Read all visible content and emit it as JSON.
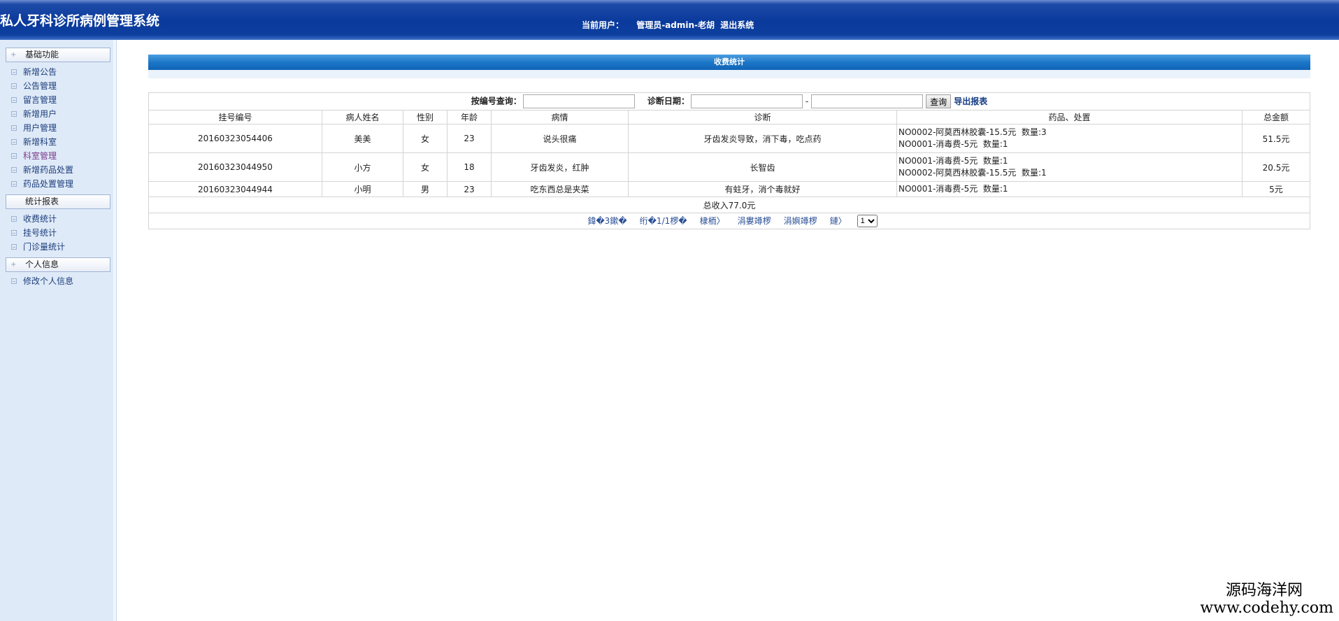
{
  "header": {
    "title": "私人牙科诊所病例管理系统",
    "current_user_label": "当前用户：",
    "current_user": "管理员-admin-老胡",
    "logout": "退出系统"
  },
  "sidebar": {
    "sections": [
      {
        "title": "基础功能",
        "items": [
          "新增公告",
          "公告管理",
          "留言管理",
          "新增用户",
          "用户管理",
          "新增科室",
          "科室管理",
          "新增药品处置",
          "药品处置管理"
        ]
      },
      {
        "title": "统计报表",
        "items": [
          "收费统计",
          "挂号统计",
          "门诊量统计"
        ]
      },
      {
        "title": "个人信息",
        "items": [
          "修改个人信息"
        ]
      }
    ]
  },
  "main": {
    "panel_title": "收费统计",
    "search": {
      "by_number_label": "按编号查询：",
      "by_number_value": "",
      "date_label": "诊断日期：",
      "date_from": "",
      "date_sep": "-",
      "date_to": "",
      "query_button": "查询",
      "export_link": "导出报表"
    },
    "columns": [
      "挂号编号",
      "病人姓名",
      "性别",
      "年龄",
      "病情",
      "诊断",
      "药品、处置",
      "总金额"
    ],
    "rows": [
      {
        "reg_no": "20160323054406",
        "name": "美美",
        "gender": "女",
        "age": "23",
        "condition": "说头很痛",
        "diagnosis": "牙齿发炎导致，消下毒，吃点药",
        "meds": [
          "NO0002-阿莫西林胶囊-15.5元  数量:3",
          "NO0001-消毒费-5元  数量:1"
        ],
        "total": "51.5元"
      },
      {
        "reg_no": "20160323044950",
        "name": "小方",
        "gender": "女",
        "age": "18",
        "condition": "牙齿发炎，红肿",
        "diagnosis": "长智齿",
        "meds": [
          "NO0001-消毒费-5元  数量:1",
          "NO0002-阿莫西林胶囊-15.5元  数量:1"
        ],
        "total": "20.5元"
      },
      {
        "reg_no": "20160323044944",
        "name": "小明",
        "gender": "男",
        "age": "23",
        "condition": "吃东西总是夹菜",
        "diagnosis": "有蛀牙，消个毒就好",
        "meds": [
          "NO0001-消毒费-5元  数量:1"
        ],
        "total": "5元"
      }
    ],
    "total_income": "总收入77.0元",
    "pager": {
      "links": [
        "鍏�3鏉�",
        "绗�1/1椤�",
        "棣栭〉",
        "涓婁竴椤",
        "涓嬩竴椤",
        "鏈〉"
      ],
      "page_select": "1"
    }
  },
  "watermark": {
    "line1": "源码海洋网",
    "line2": "www.codehy.com"
  }
}
